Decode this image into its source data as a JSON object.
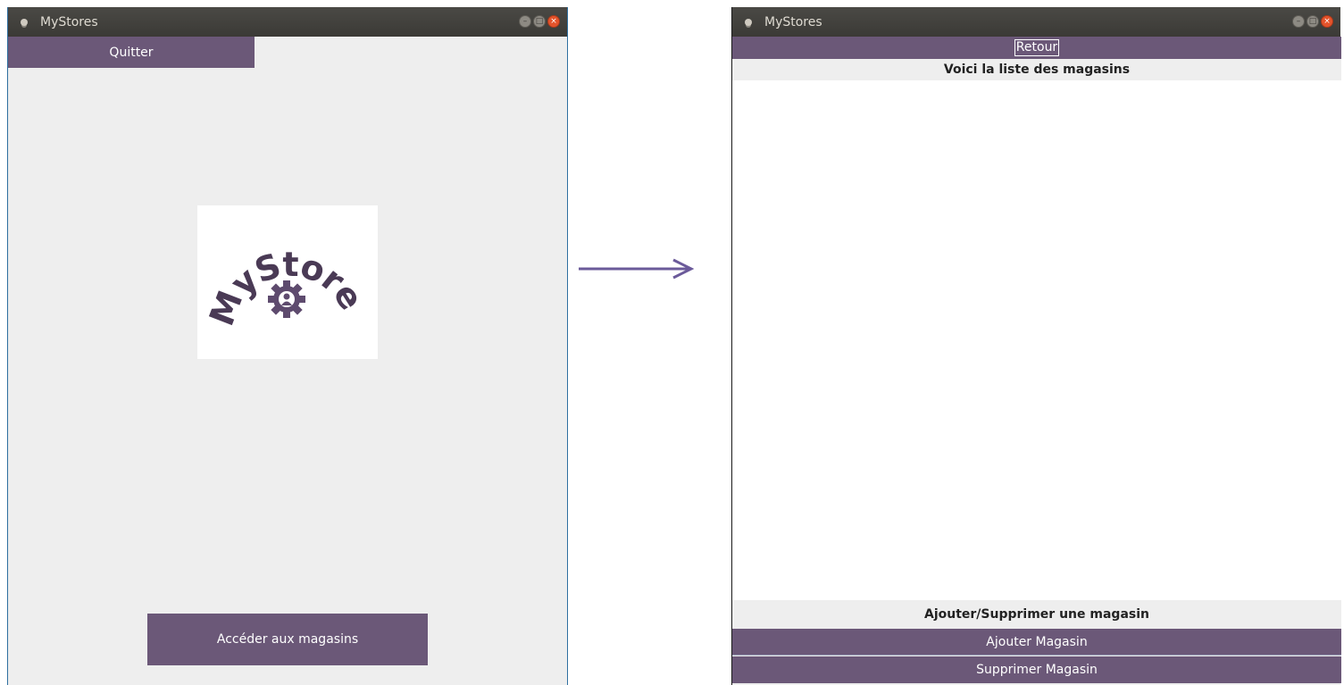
{
  "left_window": {
    "title": "MyStores",
    "quit_label": "Quitter",
    "logo_text": "MyStores",
    "access_label": "Accéder aux magasins"
  },
  "right_window": {
    "title": "MyStores",
    "back_label": "Retour",
    "list_title": "Voici la liste des magasins",
    "stores": [],
    "edit_title": "Ajouter/Supprimer une magasin",
    "add_label": "Ajouter Magasin",
    "delete_label": "Supprimer Magasin"
  },
  "colors": {
    "accent": "#6b5878",
    "titlebar": "#3b3a36",
    "window_bg": "#eeeeee",
    "close_button": "#e4532b"
  },
  "icons": {
    "app": "app-icon",
    "minimize": "minimize-icon",
    "maximize": "maximize-icon",
    "close": "close-icon",
    "logo_gear": "gear-icon",
    "transition": "arrow-right-icon"
  }
}
